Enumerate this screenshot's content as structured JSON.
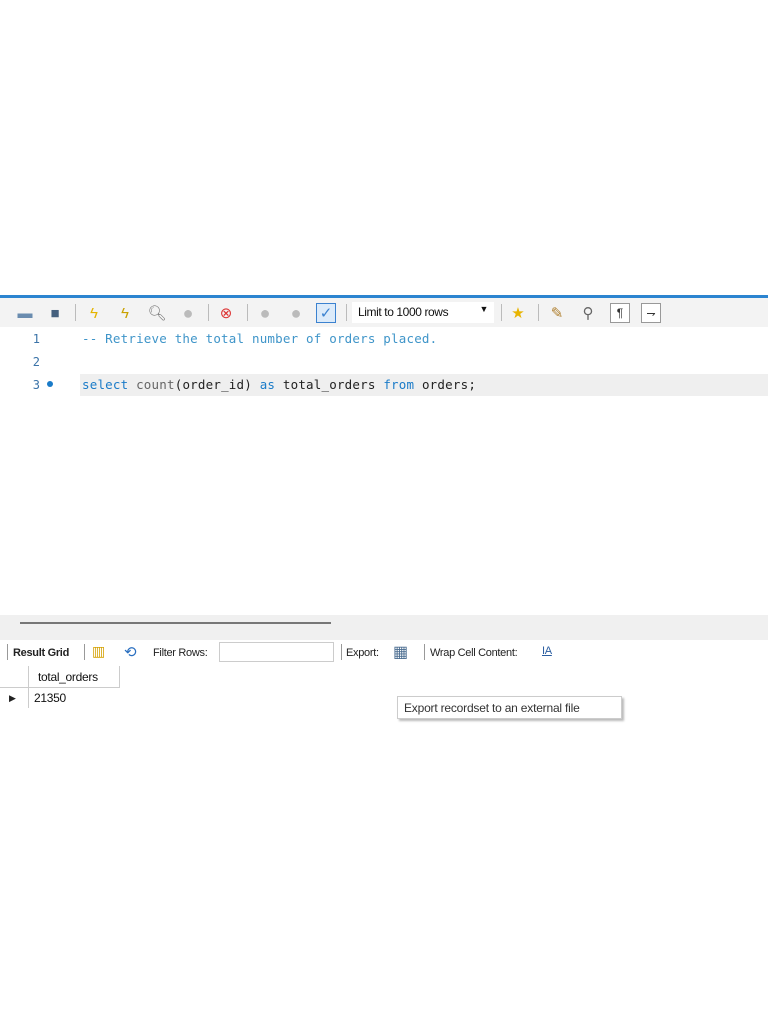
{
  "toolbar": {
    "icons": [
      "open-folder-icon",
      "save-icon",
      "execute-icon",
      "execute-current-icon",
      "explain-icon",
      "stop-icon",
      "toggle-error-icon",
      "commit-icon",
      "rollback-icon",
      "autocommit-icon",
      "add-snippet-icon",
      "beautify-icon",
      "find-icon",
      "invisible-chars-icon",
      "word-wrap-icon"
    ],
    "limit_select": "Limit to 1000 rows"
  },
  "editor": {
    "lines": [
      {
        "number": "1",
        "comment": "-- Retrieve the total number of orders placed."
      },
      {
        "number": "2"
      },
      {
        "number": "3",
        "tokens": [
          "select",
          " count",
          "(order_id) ",
          "as",
          " total_orders ",
          "from",
          " orders;"
        ]
      }
    ]
  },
  "results": {
    "result_grid_label": "Result Grid",
    "filter_label": "Filter Rows:",
    "filter_value": "",
    "export_label": "Export:",
    "wrap_label": "Wrap Cell Content:",
    "columns": [
      "total_orders"
    ],
    "rows": [
      [
        "21350"
      ]
    ]
  },
  "tooltip": "Export recordset to an external file"
}
